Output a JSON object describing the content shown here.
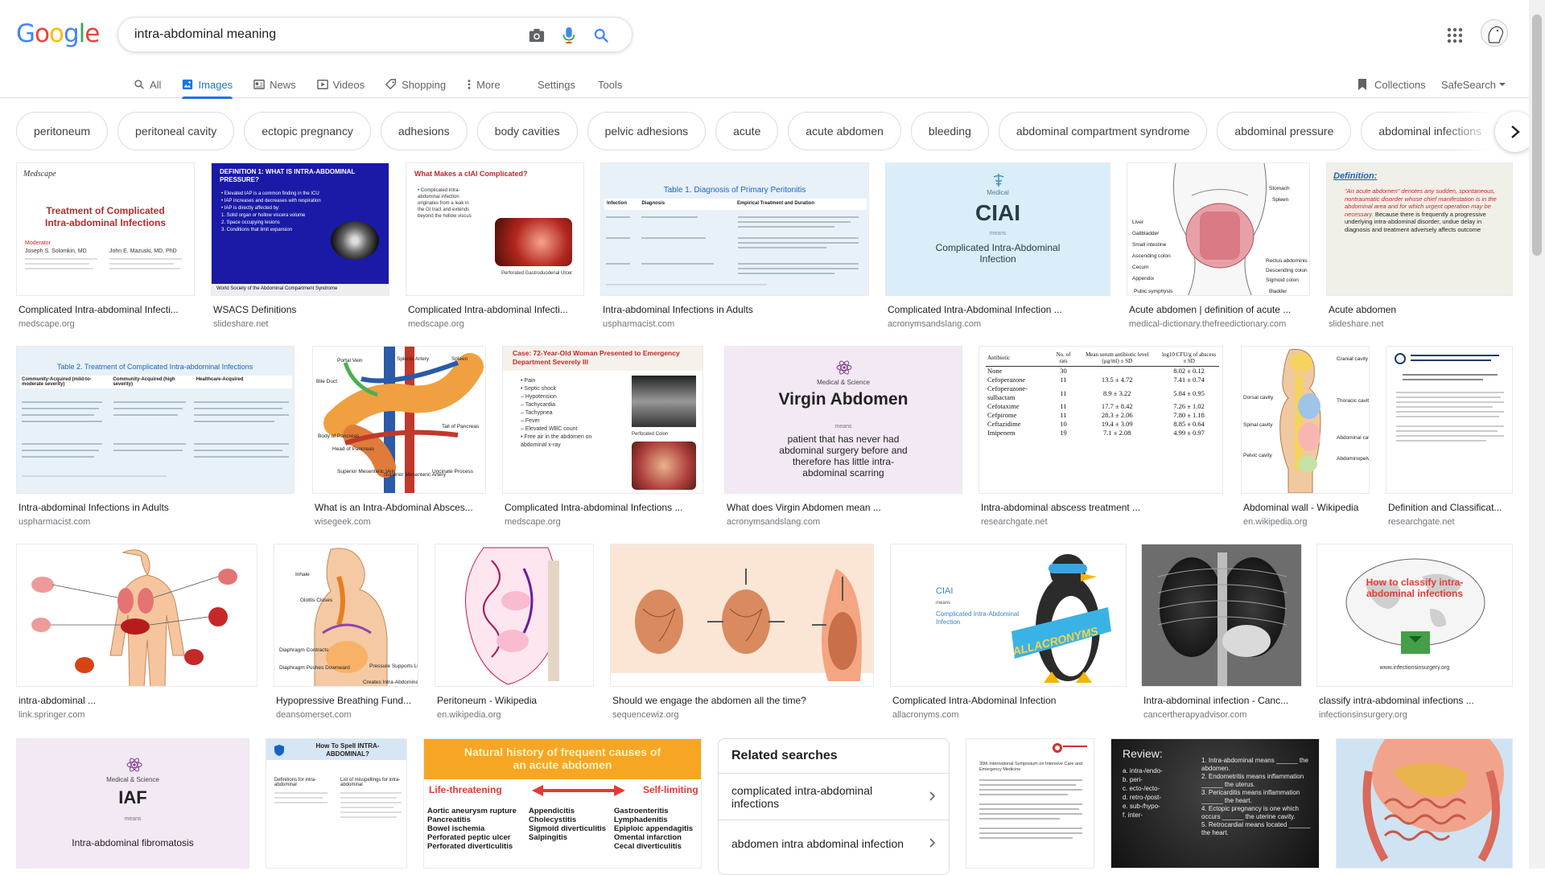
{
  "header": {
    "logo": [
      "G",
      "o",
      "o",
      "g",
      "l",
      "e"
    ],
    "logo_colors": [
      "#4285F4",
      "#EA4335",
      "#FBBC05",
      "#4285F4",
      "#34A853",
      "#EA4335"
    ],
    "query": "intra-abdominal meaning"
  },
  "tabs": [
    {
      "label": "All",
      "icon": "search-icon"
    },
    {
      "label": "Images",
      "icon": "image-icon",
      "active": true
    },
    {
      "label": "News",
      "icon": "news-icon"
    },
    {
      "label": "Videos",
      "icon": "video-icon"
    },
    {
      "label": "Shopping",
      "icon": "tag-icon"
    },
    {
      "label": "More",
      "icon": "more-vert-icon"
    }
  ],
  "settings_label": "Settings",
  "tools_label": "Tools",
  "collections_label": "Collections",
  "safesearch_label": "SafeSearch",
  "chips": [
    "peritoneum",
    "peritoneal cavity",
    "ectopic pregnancy",
    "adhesions",
    "body cavities",
    "pelvic adhesions",
    "acute",
    "acute abdomen",
    "bleeding",
    "abdominal compartment syndrome",
    "abdominal pressure",
    "abdominal infections",
    "intraperitoneal"
  ],
  "results": {
    "row1": [
      {
        "title": "Complicated Intra-abdominal Infecti...",
        "source": "medscape.org",
        "thumb": {
          "brand": "Medscape",
          "heading": "Treatment of Complicated Intra-abdominal Infections",
          "small1": "Moderator",
          "small2": "Joseph S. Solomkin, MD",
          "small3": "John E. Mazuski, MD, PhD"
        }
      },
      {
        "title": "WSACS Definitions",
        "source": "slideshare.net",
        "thumb": {
          "heading": "DEFINITION 1: WHAT IS INTRA-ABDOMINAL PRESSURE?",
          "lines": [
            "• Elevated IAP is a common finding in the ICU",
            "• IAP increases and decreases with respiration",
            "• IAP is directly affected by:",
            "1. Solid organ or hollow viscera volume",
            "2. Space occupying lesions",
            "3. Conditions that limit expansion"
          ],
          "footer": "World Society of the Abdominal Compartment Syndrome"
        }
      },
      {
        "title": "Complicated Intra-abdominal Infecti...",
        "source": "medscape.org",
        "thumb": {
          "heading": "What Makes a cIAI Complicated?",
          "lines": [
            "• Complicated intra-",
            "abdominal infection",
            "originates from a leak in",
            "the GI tract and extends",
            "beyond the hollow viscus"
          ],
          "caption": "Perforated Gastroduodenal Ulcer"
        }
      },
      {
        "title": "Intra-abdominal Infections in Adults",
        "source": "uspharmacist.com",
        "thumb": {
          "heading": "Table 1. Diagnosis of Primary Peritonitis",
          "cols": [
            "Infection",
            "Diagnosis",
            "Empirical Treatment and Duration"
          ]
        }
      },
      {
        "title": "Complicated Intra-Abdominal Infection ...",
        "source": "acronymsandslang.com",
        "thumb": {
          "small": "Medical",
          "big": "CIAI",
          "means": "means",
          "body": "Complicated Intra-Abdominal Infection"
        }
      },
      {
        "title": "Acute abdomen | definition of acute ...",
        "source": "medical-dictionary.thefreedictionary.com",
        "thumb": {
          "labels": [
            "Stomach",
            "Spleen",
            "Liver",
            "Gallbladder",
            "Small intestine",
            "Ascending colon",
            "Cecum",
            "Appendix",
            "Pubic symphysis",
            "Rectus abdominis",
            "Descending colon",
            "Sigmoid colon",
            "Bladder"
          ]
        }
      },
      {
        "title": "Acute abdomen",
        "source": "slideshare.net",
        "thumb": {
          "heading": "Definition:",
          "red": "\"An acute abdomen\" denotes any sudden, spontaneous, nontraumatic disorder whose chief manifestation is in the abdominal area and for which urgent operation may be necessary.",
          "black": "Because there is frequently a progressive underlying intra-abdominal disorder, undue delay in diagnosis and treatment adversely affects outcome"
        }
      }
    ],
    "row2": [
      {
        "title": "Intra-abdominal Infections in Adults",
        "source": "uspharmacist.com",
        "thumb": {
          "heading": "Table 2. Treatment of Complicated Intra-abdominal Infections",
          "cols": [
            "Community-Acquired (mild-to-moderate severity)",
            "Community-Acquired (high severity)",
            "Healthcare-Acquired"
          ]
        }
      },
      {
        "title": "What is an Intra-Abdominal Absces...",
        "source": "wisegeek.com",
        "thumb": {
          "labels": [
            "Portal Vein",
            "Splenic Artery",
            "Spleen",
            "Bile Duct",
            "Tail of Pancreas",
            "Body of Pancreas",
            "Head of Pancreas",
            "Superior Mesenteric Vein",
            "Superior Mesenteric Artery",
            "Uncinate Process"
          ]
        }
      },
      {
        "title": "Complicated Intra-abdominal Infections ...",
        "source": "medscape.org",
        "thumb": {
          "heading": "Case: 72-Year-Old Woman Presented to Emergency Department Severely Ill",
          "lines": [
            "• Pain",
            "• Septic shock",
            "– Hypotension",
            "– Tachycardia",
            "– Tachypnea",
            "– Fever",
            "– Elevated WBC count",
            "• Free air in the abdomen on abdominal x-ray"
          ],
          "caption": "Perforated Colon"
        }
      },
      {
        "title": "What does Virgin Abdomen mean ...",
        "source": "acronymsandslang.com",
        "thumb": {
          "small": "Medical & Science",
          "big": "Virgin Abdomen",
          "means": "means",
          "body": "patient that has never had abdominal surgery before and therefore has little intra-abdominal scarring"
        }
      },
      {
        "title": "Intra-abdominal abscess treatment ...",
        "source": "researchgate.net",
        "thumb": {
          "cols": [
            "Antibiotic",
            "No. of rats",
            "Mean serum antibiotic level (µg/ml) ± SD",
            "log10 CFU/g of abscess ± SD"
          ],
          "rows": [
            [
              "None",
              "30",
              "",
              "8.02 ± 0.12"
            ],
            [
              "Cefoperazone",
              "11",
              "13.5 ± 4.72",
              "7.41 ± 0.74"
            ],
            [
              "Cefoperazone-sulbactam",
              "11",
              "8.9 ± 3.22",
              "5.84 ± 0.95"
            ],
            [
              "Cefotaxime",
              "11",
              "17.7 ± 8.42",
              "7.26 ± 1.02"
            ],
            [
              "Cefpirome",
              "11",
              "28.3 ± 2.06",
              "7.80 ± 1.18"
            ],
            [
              "Ceftazidime",
              "10",
              "19.4 ± 3.09",
              "8.85 ± 0.64"
            ],
            [
              "Imipenem",
              "19",
              "7.1 ± 2.08",
              "4.99 ± 0.97"
            ]
          ]
        }
      },
      {
        "title": "Abdominal wall - Wikipedia",
        "source": "en.wikipedia.org",
        "thumb": {
          "labels": [
            "Cranial cavity",
            "Dorsal cavity",
            "Thoracic cavity",
            "Spinal cavity",
            "Abdominal cavity",
            "Pelvic cavity",
            "Abdominopelvic cavity"
          ]
        }
      },
      {
        "title": "Definition and Classificat...",
        "source": "researchgate.net",
        "thumb": {}
      }
    ],
    "row3": [
      {
        "title": "intra-abdominal ...",
        "source": "link.springer.com",
        "thumb": {}
      },
      {
        "title": "Hypopressive Breathing Fund...",
        "source": "deansomerset.com",
        "thumb": {
          "labels": [
            "Inhale",
            "Glottis Closes",
            "Diaphragm Contracts",
            "Diaphragm Pushes Downward",
            "Pressure Supports Lumbar Spine",
            "Creates Intra-Abdominal Pressure"
          ]
        }
      },
      {
        "title": "Peritoneum - Wikipedia",
        "source": "en.wikipedia.org",
        "thumb": {}
      },
      {
        "title": "Should we engage the abdomen all the time?",
        "source": "sequencewiz.org",
        "thumb": {}
      },
      {
        "title": "Complicated Intra-Abdominal Infection",
        "source": "allacronyms.com",
        "thumb": {
          "big": "CIAI",
          "means": "means",
          "body": "Complicated Intra-Abdominal Infection",
          "brand": "ALLACRONYMS"
        }
      },
      {
        "title": "Intra-abdominal infection - Canc...",
        "source": "cancertherapyadvisor.com",
        "thumb": {}
      },
      {
        "title": "classify intra-abdominal infections ...",
        "source": "infectionsinsurgery.org",
        "thumb": {
          "heading": "How to classify intra-abdominal infections",
          "url": "www.infectionsinsurgery.org"
        }
      }
    ],
    "row4": [
      {
        "thumb": {
          "small": "Medical & Science",
          "big": "IAF",
          "means": "means",
          "body": "Intra-abdominal fibromatosis"
        }
      },
      {
        "thumb": {
          "heading": "How To Spell INTRA-ABDOMINAL?",
          "sub1": "Definitions for intra-abdominal",
          "sub2": "List of misspellings for intra-abdominal"
        }
      },
      {
        "thumb": {
          "heading": "Natural history of frequent causes of an acute abdomen",
          "left": "Life-threatening",
          "right": "Self-limiting",
          "col1": [
            "Aortic aneurysm rupture",
            "Pancreatitis",
            "Bowel ischemia",
            "Perforated peptic ulcer",
            "Perforated diverticulitis"
          ],
          "col2": [
            "Appendicitis",
            "Cholecystitis",
            "Sigmoid diverticulitis",
            "Salpingitis"
          ],
          "col3": [
            "Gastroenteritis",
            "Lymphadenitis",
            "Epiploic appendagitis",
            "Omental infarction",
            "Cecal diverticulitis"
          ]
        }
      },
      {
        "thumb": {
          "heading": "30th International Symposium on Intensive Care and Emergency Medicine"
        }
      },
      {
        "thumb": {
          "heading": "Review:",
          "left": [
            "a. intra-/endo-",
            "b. peri-",
            "c. ecto-/ecto-",
            "d. retro-/post-",
            "e. sub-/hypo-",
            "f. inter-"
          ],
          "right": [
            "1. Intra-abdominal means ______ the abdomen.",
            "2. Endometritis means inflammation ______ the uterus.",
            "3. Pericarditis means inflammation ______ the heart.",
            "4. Ectopic pregnancy is one which occurs ______ the uterine cavity.",
            "5. Retrocardial means located ______ the heart."
          ]
        }
      },
      {
        "thumb": {}
      }
    ]
  },
  "related": {
    "title": "Related searches",
    "items": [
      "complicated intra-abdominal infections",
      "abdomen intra abdominal infection"
    ]
  }
}
